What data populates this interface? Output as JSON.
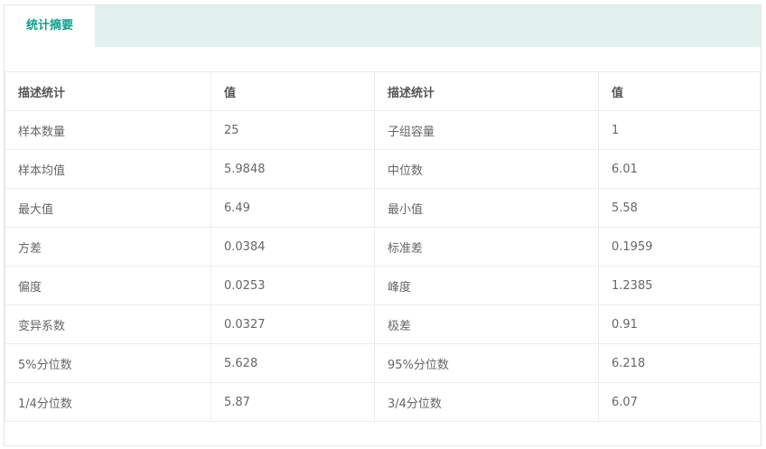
{
  "tabs": [
    {
      "label": "统计摘要",
      "active": true
    }
  ],
  "colors": {
    "tab_active_text": "#129c8c",
    "tab_bar_background": "#e0f1ee",
    "border": "#ececec"
  },
  "table": {
    "headers": [
      "描述统计",
      "值",
      "描述统计",
      "值"
    ],
    "rows": [
      [
        "样本数量",
        "25",
        "子组容量",
        "1"
      ],
      [
        "样本均值",
        "5.9848",
        "中位数",
        "6.01"
      ],
      [
        "最大值",
        "6.49",
        "最小值",
        "5.58"
      ],
      [
        "方差",
        "0.0384",
        "标准差",
        "0.1959"
      ],
      [
        "偏度",
        "0.0253",
        "峰度",
        "1.2385"
      ],
      [
        "变异系数",
        "0.0327",
        "极差",
        "0.91"
      ],
      [
        "5%分位数",
        "5.628",
        "95%分位数",
        "6.218"
      ],
      [
        "1/4分位数",
        "5.87",
        "3/4分位数",
        "6.07"
      ]
    ]
  }
}
